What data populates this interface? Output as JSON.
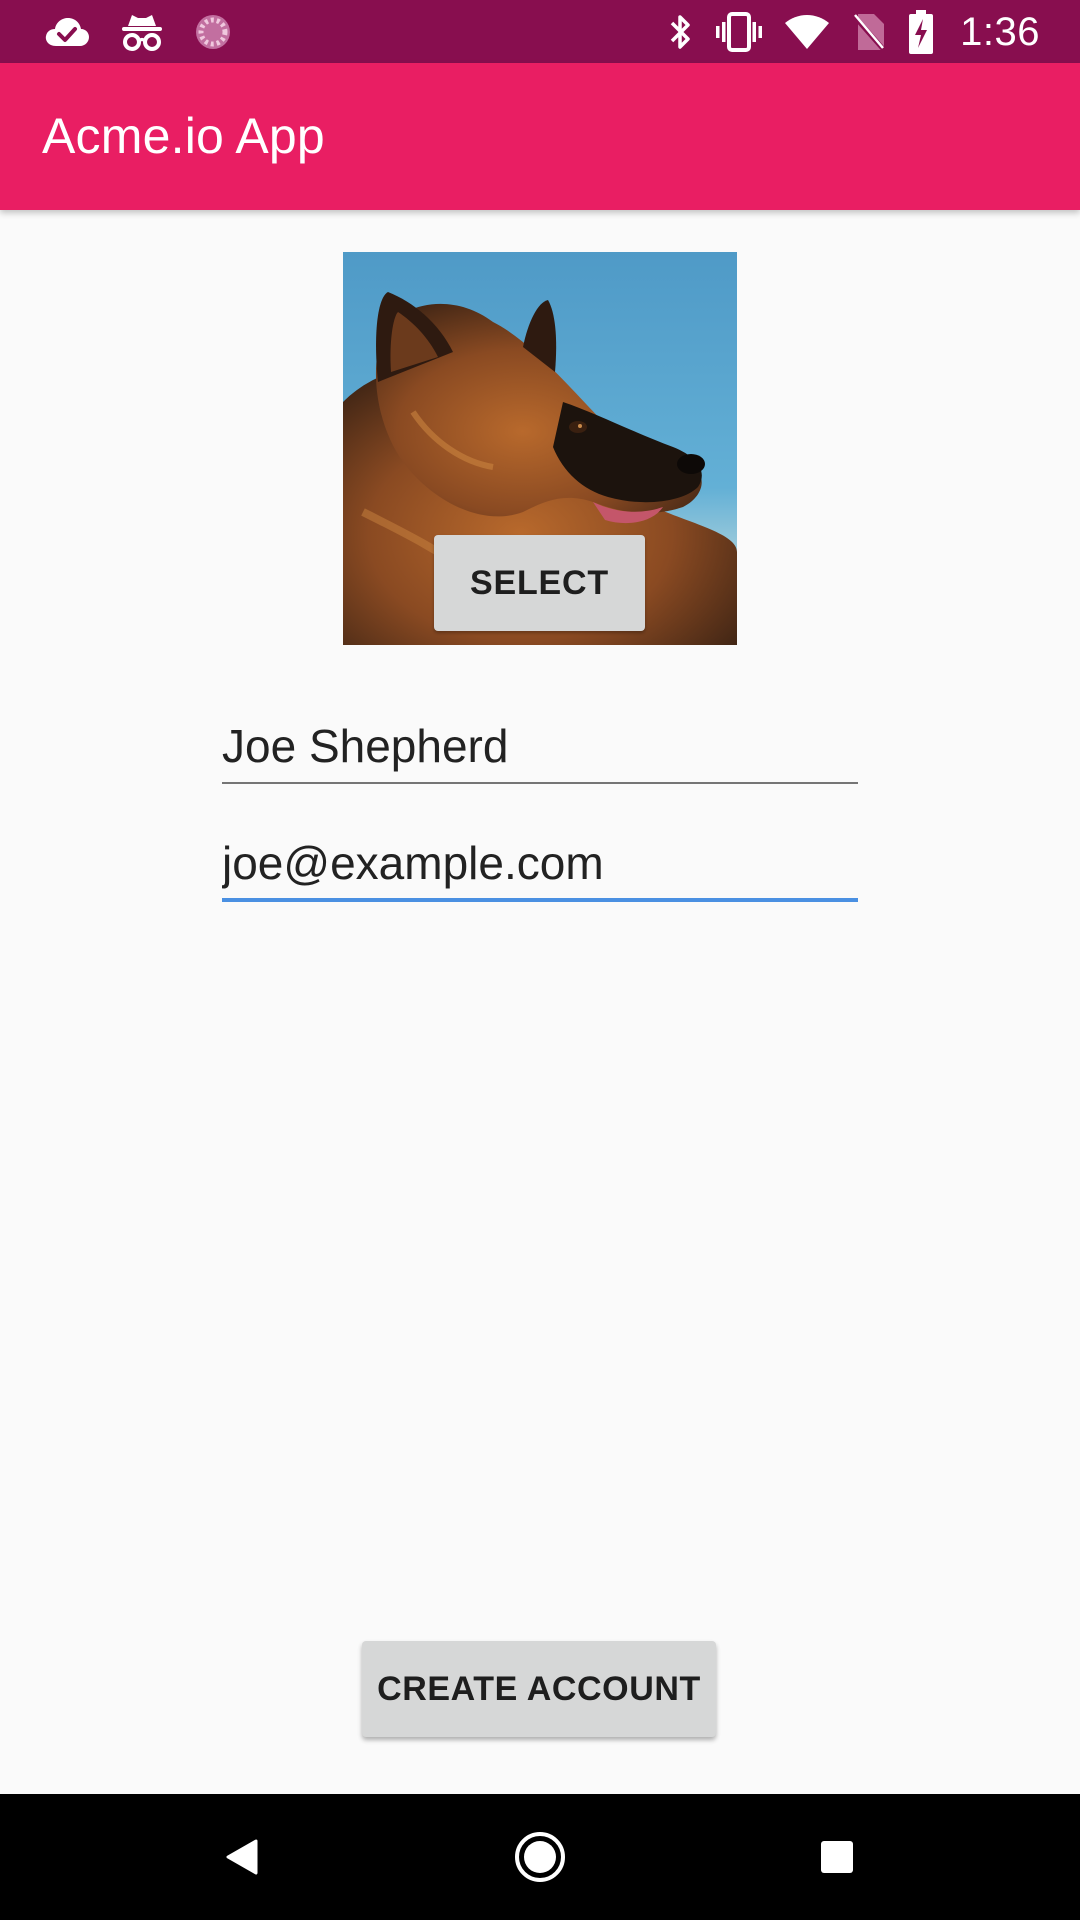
{
  "status_bar": {
    "time": "1:36",
    "left_icons": [
      "cloud-check-icon",
      "incognito-icon",
      "loading-spinner-icon"
    ],
    "right_icons": [
      "bluetooth-icon",
      "vibrate-icon",
      "wifi-icon",
      "no-sim-icon",
      "battery-charging-icon"
    ],
    "background_color": "#880E4F"
  },
  "app_bar": {
    "title": "Acme.io App",
    "background_color": "#E91E63"
  },
  "profile": {
    "photo_icon": "dog-photo",
    "select_label": "SELECT"
  },
  "form": {
    "name_value": "Joe Shepherd",
    "email_value": "joe@example.com",
    "focused_field_color": "#4A90E2"
  },
  "actions": {
    "create_account_label": "CREATE ACCOUNT"
  },
  "nav_bar": {
    "icons": [
      "back-icon",
      "home-icon",
      "recents-icon"
    ]
  }
}
